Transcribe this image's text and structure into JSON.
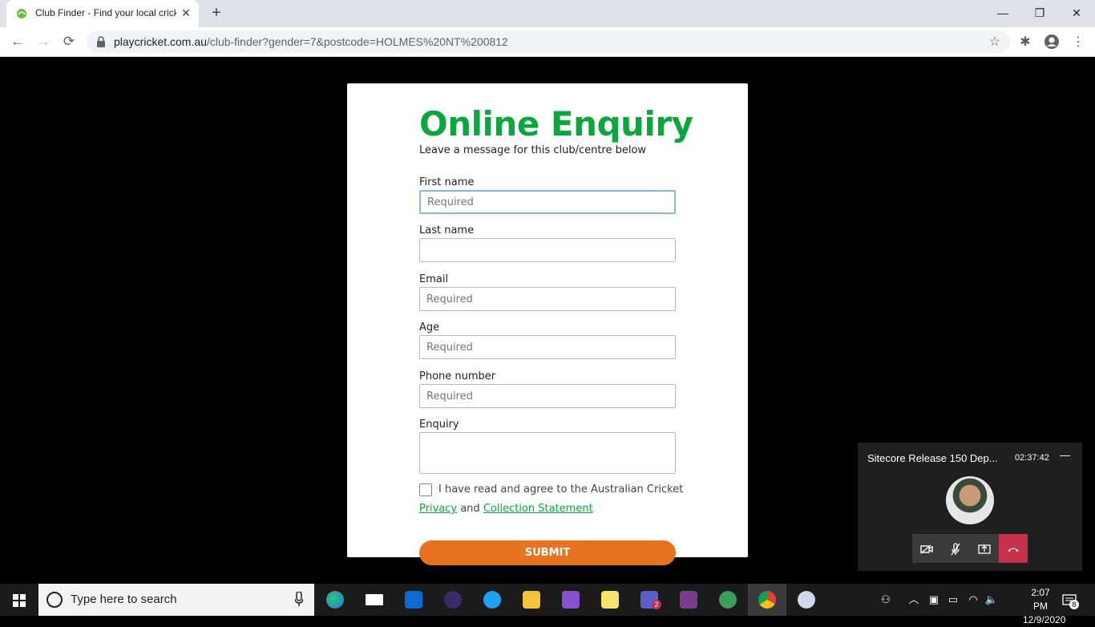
{
  "browser": {
    "tab_title": "Club Finder - Find your local cricket",
    "tab_close": "✕",
    "new_tab": "+",
    "url_host": "playcricket.com.au",
    "url_path": "/club-finder?gender=7&postcode=HOLMES%20NT%200812",
    "window": {
      "minimize": "—",
      "restore": "❐",
      "close": "✕"
    },
    "nav": {
      "back": "←",
      "forward": "→",
      "reload": "⟳"
    }
  },
  "form": {
    "title": "Online Enquiry",
    "subtitle": "Leave a message for this club/centre below",
    "fields": [
      {
        "label": "First name",
        "placeholder": "Required"
      },
      {
        "label": "Last name",
        "placeholder": ""
      },
      {
        "label": "Email",
        "placeholder": "Required"
      },
      {
        "label": "Age",
        "placeholder": "Required"
      },
      {
        "label": "Phone number",
        "placeholder": "Required"
      }
    ],
    "enquiry_label": "Enquiry",
    "consent_text": "I have read and agree to the Australian Cricket",
    "privacy_link": "Privacy",
    "consent_and": "and",
    "collection_link": "Collection Statement",
    "submit_label": "SUBMIT"
  },
  "call": {
    "title": "Sitecore Release 150 Dep...",
    "duration": "02:37:42",
    "minimize": "—"
  },
  "taskbar": {
    "search_placeholder": "Type here to search",
    "time": "2:07 PM",
    "date": "12/9/2020",
    "notifications": "8",
    "teams_badge": "2"
  },
  "colors": {
    "brand_green": "#0ba63d",
    "submit_orange": "#e8731f",
    "hangup_red": "#c4314b"
  }
}
